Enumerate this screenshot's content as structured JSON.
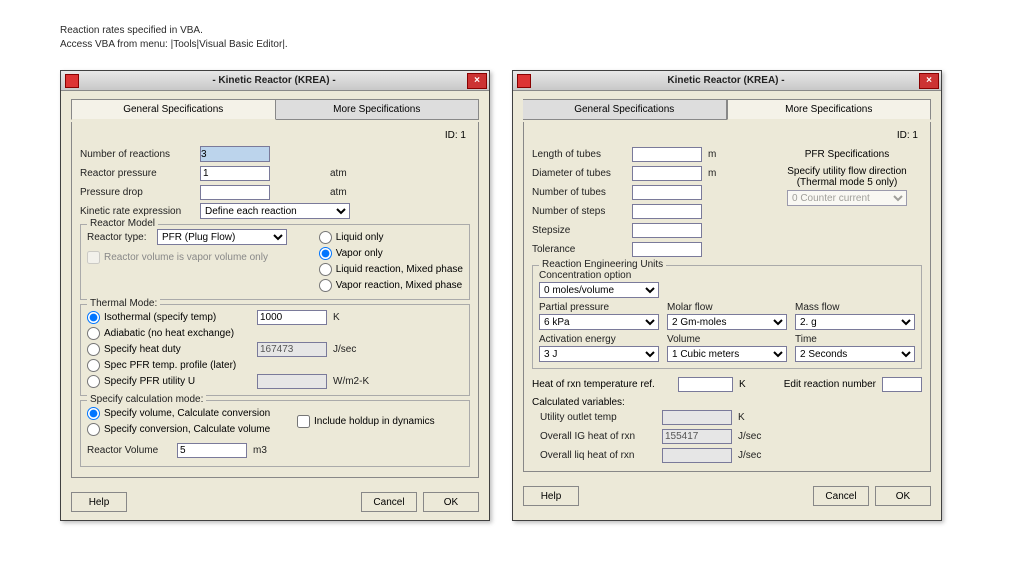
{
  "topnote_line1": "Reaction rates specified in VBA.",
  "topnote_line2": "Access VBA from menu: |Tools|Visual Basic Editor|.",
  "left": {
    "title": "- Kinetic Reactor (KREA) -",
    "tab_general": "General Specifications",
    "tab_more": "More Specifications",
    "id_label": "ID:    1",
    "num_reactions_lbl": "Number of reactions",
    "num_reactions_val": "3",
    "reactor_pressure_lbl": "Reactor pressure",
    "reactor_pressure_val": "1",
    "reactor_pressure_unit": "atm",
    "pressure_drop_lbl": "Pressure drop",
    "pressure_drop_val": "",
    "pressure_drop_unit": "atm",
    "kinetic_rate_lbl": "Kinetic rate expression",
    "kinetic_rate_val": "Define each reaction",
    "reactor_model_title": "Reactor Model",
    "reactor_type_lbl": "Reactor type:",
    "reactor_type_val": "PFR (Plug Flow)",
    "phase_liquid_only": "Liquid only",
    "phase_vapor_only": "Vapor only",
    "phase_liquid_mixed": "Liquid reaction, Mixed phase",
    "phase_vapor_mixed": "Vapor reaction, Mixed phase",
    "vaporvol_chk": "Reactor volume is vapor volume only",
    "thermal_title": "Thermal Mode:",
    "th_iso": "Isothermal (specify temp)",
    "th_adia": "Adiabatic (no heat exchange)",
    "th_duty": "Specify heat duty",
    "th_profile": "Spec PFR temp. profile (later)",
    "th_pfru": "Specify PFR utility U",
    "th_iso_val": "1000",
    "th_iso_unit": "K",
    "th_duty_val": "167473",
    "th_duty_unit": "J/sec",
    "th_pfru_val": "",
    "th_pfru_unit": "W/m2-K",
    "calc_title": "Specify calculation mode:",
    "calc_vol": "Specify volume, Calculate conversion",
    "calc_conv": "Specify conversion, Calculate volume",
    "holdup_chk": "Include holdup in dynamics",
    "reactor_vol_lbl": "Reactor Volume",
    "reactor_vol_val": "5",
    "reactor_vol_unit": "m3",
    "help": "Help",
    "cancel": "Cancel",
    "ok": "OK"
  },
  "right": {
    "title": "Kinetic Reactor (KREA) -",
    "tab_general": "General Specifications",
    "tab_more": "More Specifications",
    "id_label": "ID:    1",
    "len_lbl": "Length of tubes",
    "len_val": "",
    "len_unit": "m",
    "dia_lbl": "Diameter of tubes",
    "dia_val": "",
    "dia_unit": "m",
    "ntubes_lbl": "Number of tubes",
    "ntubes_val": "",
    "nsteps_lbl": "Number of steps",
    "nsteps_val": "",
    "step_lbl": "Stepsize",
    "step_val": "",
    "tol_lbl": "Tolerance",
    "tol_val": "",
    "pfr_title": "PFR Specifications",
    "pfr_dir_lbl": "Specify utility flow direction\n(Thermal mode 5 only)",
    "pfr_dir_val": "0 Counter current",
    "reu_title": "Reaction Engineering Units",
    "conc_lbl": "Concentration option",
    "conc_val": "0 moles/volume",
    "pp_lbl": "Partial pressure",
    "pp_val": "6 kPa",
    "mf_lbl": "Molar flow",
    "mf_val": "2 Gm-moles",
    "massf_lbl": "Mass flow",
    "massf_val": "2. g",
    "ae_lbl": "Activation energy",
    "ae_val": "3 J",
    "vol_lbl": "Volume",
    "vol_val": "1 Cubic meters",
    "time_lbl": "Time",
    "time_val": "2 Seconds",
    "heatref_lbl": "Heat of rxn temperature ref.",
    "heatref_val": "",
    "heatref_unit": "K",
    "editrxn_lbl": "Edit reaction number",
    "editrxn_val": "",
    "calcvar_lbl": "Calculated variables:",
    "uout_lbl": "Utility outlet temp",
    "uout_val": "",
    "uout_unit": "K",
    "igheat_lbl": "Overall IG heat of rxn",
    "igheat_val": "155417",
    "igheat_unit": "J/sec",
    "liqheat_lbl": "Overall liq heat of rxn",
    "liqheat_val": "",
    "liqheat_unit": "J/sec",
    "help": "Help",
    "cancel": "Cancel",
    "ok": "OK"
  }
}
